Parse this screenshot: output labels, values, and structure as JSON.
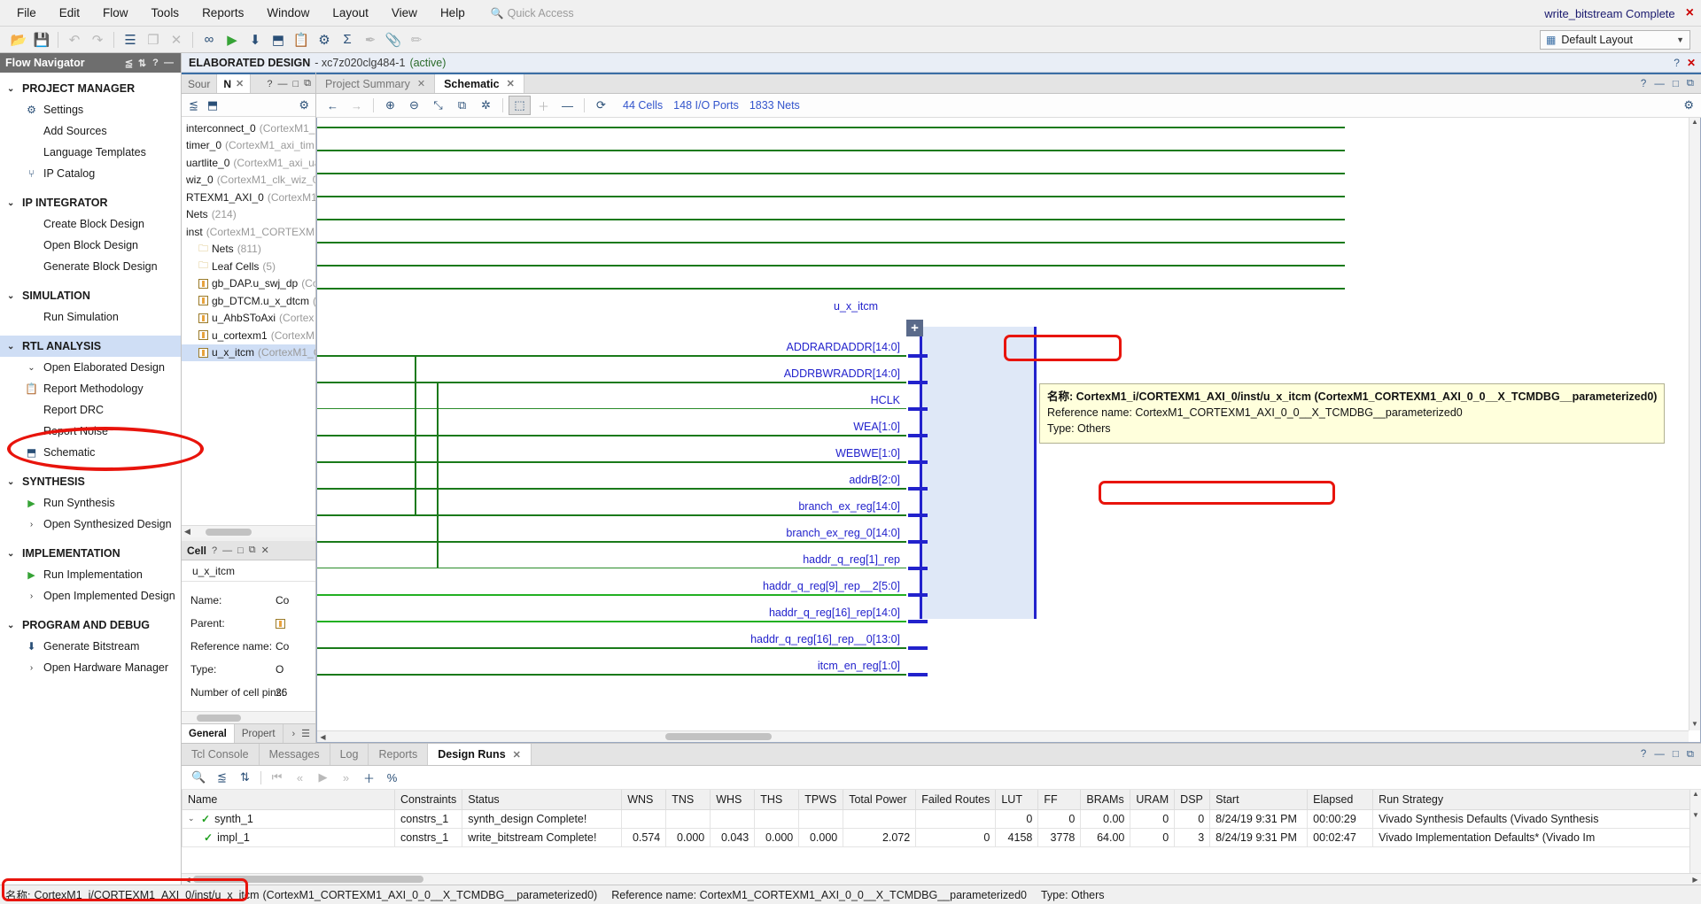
{
  "menubar": {
    "items": [
      "File",
      "Edit",
      "Flow",
      "Tools",
      "Reports",
      "Window",
      "Layout",
      "View",
      "Help"
    ],
    "quick_access_placeholder": "Quick Access",
    "status": "write_bitstream Complete",
    "close_label": "×"
  },
  "toolbar": {
    "layout_label": "Default Layout",
    "buttons": [
      {
        "name": "open-project-icon",
        "glyph": "📂",
        "state": "enabled"
      },
      {
        "name": "save-icon",
        "glyph": "💾",
        "state": "disabled"
      },
      {
        "name": "undo-icon",
        "glyph": "↶",
        "state": "disabled"
      },
      {
        "name": "redo-icon",
        "glyph": "↷",
        "state": "disabled"
      },
      {
        "name": "report-icon",
        "glyph": "☰",
        "state": "enabled"
      },
      {
        "name": "copy-icon",
        "glyph": "❐",
        "state": "disabled"
      },
      {
        "name": "close-icon",
        "glyph": "✕",
        "state": "disabled"
      },
      {
        "name": "binoculars-icon",
        "glyph": "∞",
        "state": "enabled"
      },
      {
        "name": "run-icon",
        "glyph": "▶",
        "state": "green"
      },
      {
        "name": "generate-bitstream-icon",
        "glyph": "⬇",
        "state": "enabled"
      },
      {
        "name": "schematic-icon",
        "glyph": "⬒",
        "state": "enabled"
      },
      {
        "name": "report-methodology-icon",
        "glyph": "📋",
        "state": "enabled"
      },
      {
        "name": "settings-gear-icon",
        "glyph": "⚙",
        "state": "enabled"
      },
      {
        "name": "sum-icon",
        "glyph": "Σ",
        "state": "enabled"
      },
      {
        "name": "marker-icon",
        "glyph": "✒",
        "state": "disabled"
      },
      {
        "name": "pin-icon",
        "glyph": "📎",
        "state": "disabled"
      },
      {
        "name": "ruler-icon",
        "glyph": "✃",
        "state": "disabled"
      }
    ]
  },
  "flow_navigator": {
    "title": "Flow Navigator",
    "header_buttons": [
      "⨍",
      "⇅",
      "?",
      "—"
    ],
    "sections": [
      {
        "label": "PROJECT MANAGER",
        "highlight": false,
        "items": [
          {
            "label": "Settings",
            "icon": "gear-icon",
            "glyph": "⚙"
          },
          {
            "label": "Add Sources",
            "icon": "",
            "glyph": ""
          },
          {
            "label": "Language Templates",
            "icon": "",
            "glyph": ""
          },
          {
            "label": "IP Catalog",
            "icon": "ip-catalog-icon",
            "glyph": "⑂"
          }
        ]
      },
      {
        "label": "IP INTEGRATOR",
        "highlight": false,
        "items": [
          {
            "label": "Create Block Design",
            "icon": "",
            "glyph": ""
          },
          {
            "label": "Open Block Design",
            "icon": "",
            "glyph": ""
          },
          {
            "label": "Generate Block Design",
            "icon": "",
            "glyph": ""
          }
        ]
      },
      {
        "label": "SIMULATION",
        "highlight": false,
        "items": [
          {
            "label": "Run Simulation",
            "icon": "",
            "glyph": ""
          }
        ]
      },
      {
        "label": "RTL ANALYSIS",
        "highlight": true,
        "items": [
          {
            "label": "Open Elaborated Design",
            "icon": "chevron-down-icon",
            "glyph": "⌄"
          },
          {
            "label": "Report Methodology",
            "icon": "clipboard-icon",
            "glyph": "📋"
          },
          {
            "label": "Report DRC",
            "icon": "",
            "glyph": ""
          },
          {
            "label": "Report Noise",
            "icon": "",
            "glyph": ""
          },
          {
            "label": "Schematic",
            "icon": "schematic-icon",
            "glyph": "⬒"
          }
        ]
      },
      {
        "label": "SYNTHESIS",
        "highlight": false,
        "items": [
          {
            "label": "Run Synthesis",
            "icon": "play-icon",
            "glyph": "▶"
          },
          {
            "label": "Open Synthesized Design",
            "icon": "chevron-right-icon",
            "glyph": "›"
          }
        ]
      },
      {
        "label": "IMPLEMENTATION",
        "highlight": false,
        "items": [
          {
            "label": "Run Implementation",
            "icon": "play-icon",
            "glyph": "▶"
          },
          {
            "label": "Open Implemented Design",
            "icon": "chevron-right-icon",
            "glyph": "›"
          }
        ]
      },
      {
        "label": "PROGRAM AND DEBUG",
        "highlight": false,
        "items": [
          {
            "label": "Generate Bitstream",
            "icon": "generate-bitstream-icon",
            "glyph": "⬇"
          },
          {
            "label": "Open Hardware Manager",
            "icon": "chevron-right-icon",
            "glyph": "›"
          }
        ]
      }
    ]
  },
  "elaborated_bar": {
    "title": "ELABORATED DESIGN",
    "subtitle": "- xc7z020clg484-1",
    "active": "(active)",
    "help": "?",
    "close": "✕"
  },
  "sources_panel": {
    "tabs": [
      {
        "label": "Sour",
        "active": false
      },
      {
        "label": "N",
        "active": true
      }
    ],
    "toolbar_icons": [
      "collapse-all-icon",
      "schematic-icon"
    ],
    "tree": [
      {
        "label": "interconnect_0",
        "detail": "(CortexM1_",
        "indent": 0,
        "icon": "none"
      },
      {
        "label": "timer_0",
        "detail": "(CortexM1_axi_tim",
        "indent": 0,
        "icon": "none"
      },
      {
        "label": "uartlite_0",
        "detail": "(CortexM1_axi_ua",
        "indent": 0,
        "icon": "none"
      },
      {
        "label": "wiz_0",
        "detail": "(CortexM1_clk_wiz_0",
        "indent": 0,
        "icon": "none"
      },
      {
        "label": "RTEXM1_AXI_0",
        "detail": "(CortexM1_",
        "indent": 0,
        "icon": "none"
      },
      {
        "label": "Nets",
        "detail": "(214)",
        "indent": 0,
        "icon": "none"
      },
      {
        "label": "inst",
        "detail": "(CortexM1_CORTEXM1",
        "indent": 0,
        "icon": "none"
      },
      {
        "label": "Nets",
        "detail": "(811)",
        "indent": 1,
        "icon": "folder"
      },
      {
        "label": "Leaf Cells",
        "detail": "(5)",
        "indent": 1,
        "icon": "folder"
      },
      {
        "label": "gb_DAP.u_swj_dp",
        "detail": "(Co",
        "indent": 1,
        "icon": "cell"
      },
      {
        "label": "gb_DTCM.u_x_dtcm",
        "detail": "(C",
        "indent": 1,
        "icon": "cell"
      },
      {
        "label": "u_AhbSToAxi",
        "detail": "(Cortex",
        "indent": 1,
        "icon": "cell"
      },
      {
        "label": "u_cortexm1",
        "detail": "(CortexM1_",
        "indent": 1,
        "icon": "cell"
      },
      {
        "label": "u_x_itcm",
        "detail": "(CortexM1_C",
        "indent": 1,
        "icon": "cell",
        "selected": true
      }
    ]
  },
  "cell_panel": {
    "title": "Cell",
    "header_buttons": [
      "?",
      "—",
      "□",
      "❐",
      "✕"
    ],
    "cell_name": "u_x_itcm",
    "nav_left": "←",
    "nav_more": "»",
    "properties": [
      {
        "key": "Name:",
        "value": "Co"
      },
      {
        "key": "Parent:",
        "value": "",
        "has_icon": true
      },
      {
        "key": "Reference name:",
        "value": "Co"
      },
      {
        "key": "Type:",
        "value": "O"
      },
      {
        "key": "Number of cell pins:",
        "value": "26"
      }
    ],
    "tabs": [
      {
        "label": "General",
        "active": true
      },
      {
        "label": "Propert",
        "active": false
      }
    ],
    "tabs_right": [
      "›",
      "☰"
    ]
  },
  "schematic": {
    "tabs": [
      {
        "label": "Project Summary",
        "active": false
      },
      {
        "label": "Schematic",
        "active": true
      }
    ],
    "tabs_right": [
      "?",
      "—",
      "□",
      "❐"
    ],
    "toolbar": {
      "buttons": [
        {
          "name": "back-icon",
          "glyph": "←",
          "state": "enabled"
        },
        {
          "name": "forward-icon",
          "glyph": "→",
          "state": "disabled"
        },
        {
          "name": "zoom-in-icon",
          "glyph": "⊕",
          "state": "enabled"
        },
        {
          "name": "zoom-out-icon",
          "glyph": "⊖",
          "state": "enabled"
        },
        {
          "name": "zoom-fit-icon",
          "glyph": "⤡",
          "state": "enabled"
        },
        {
          "name": "zoom-area-icon",
          "glyph": "⧉",
          "state": "enabled"
        },
        {
          "name": "locate-icon",
          "glyph": "✲",
          "state": "enabled"
        },
        {
          "name": "expand-cell-icon",
          "glyph": "⬚",
          "state": "pressed"
        },
        {
          "name": "add-icon",
          "glyph": "＋",
          "state": "disabled"
        },
        {
          "name": "remove-icon",
          "glyph": "—",
          "state": "enabled"
        },
        {
          "name": "reload-icon",
          "glyph": "⟳",
          "state": "enabled"
        }
      ],
      "counts": [
        "44 Cells",
        "148 I/O Ports",
        "1833 Nets"
      ],
      "settings_icon": "gear-icon"
    },
    "block": {
      "title": "u_x_itcm",
      "expand_glyph": "+"
    },
    "port_labels": [
      "ADDRARDADDR[14:0]",
      "ADDRBWRADDR[14:0]",
      "HCLK",
      "WEA[1:0]",
      "WEBWE[1:0]",
      "addrB[2:0]",
      "branch_ex_reg[14:0]",
      "branch_ex_reg_0[14:0]",
      "haddr_q_reg[1]_rep",
      "haddr_q_reg[9]_rep__2[5:0]",
      "haddr_q_reg[16]_rep[14:0]",
      "haddr_q_reg[16]_rep__0[13:0]",
      "itcm_en_reg[1:0]"
    ],
    "tooltip": {
      "label_prefix": "名称:",
      "instance_path": "CortexM1_i/CORTEXM1_AXI_0/inst/u_x_itcm",
      "paren": "(CortexM1_CORTEXM1_AXI_0_0__X_TCMDBG__parameterized0)",
      "reference_line": "Reference name: CortexM1_CORTEXM1_AXI_0_0__X_TCMDBG__parameterized0",
      "type_line": "Type: Others"
    }
  },
  "bottom_panel": {
    "tabs": [
      {
        "label": "Tcl Console",
        "active": false
      },
      {
        "label": "Messages",
        "active": false
      },
      {
        "label": "Log",
        "active": false
      },
      {
        "label": "Reports",
        "active": false
      },
      {
        "label": "Design Runs",
        "active": true
      }
    ],
    "tabs_right": [
      "?",
      "—",
      "□",
      "❐"
    ],
    "toolbar": [
      {
        "name": "search-icon",
        "glyph": "🔍",
        "state": "enabled"
      },
      {
        "name": "collapse-all-icon",
        "glyph": "⨍",
        "state": "enabled"
      },
      {
        "name": "expand-all-icon",
        "glyph": "⇅",
        "state": "enabled"
      },
      {
        "name": "first-icon",
        "glyph": "⏮",
        "state": "disabled"
      },
      {
        "name": "prev-icon",
        "glyph": "«",
        "state": "disabled"
      },
      {
        "name": "next-icon",
        "glyph": "▶",
        "state": "disabled"
      },
      {
        "name": "last-icon",
        "glyph": "»",
        "state": "disabled"
      },
      {
        "name": "add-run-icon",
        "glyph": "＋",
        "state": "enabled"
      },
      {
        "name": "percent-icon",
        "glyph": "%",
        "state": "enabled"
      }
    ],
    "table": {
      "columns": [
        "Name",
        "Constraints",
        "Status",
        "WNS",
        "TNS",
        "WHS",
        "THS",
        "TPWS",
        "Total Power",
        "Failed Routes",
        "LUT",
        "FF",
        "BRAMs",
        "URAM",
        "DSP",
        "Start",
        "Elapsed",
        "Run Strategy"
      ],
      "rows": [
        {
          "name": "synth_1",
          "indent": 0,
          "expandable": true,
          "check": true,
          "constraints": "constrs_1",
          "status": "synth_design Complete!",
          "wns": "",
          "tns": "",
          "whs": "",
          "ths": "",
          "tpws": "",
          "total_power": "",
          "failed_routes": "",
          "lut": "0",
          "ff": "0",
          "brams": "0.00",
          "uram": "0",
          "dsp": "0",
          "start": "8/24/19 9:31 PM",
          "elapsed": "00:00:29",
          "strategy": "Vivado Synthesis Defaults (Vivado Synthesis"
        },
        {
          "name": "impl_1",
          "indent": 1,
          "expandable": false,
          "check": true,
          "constraints": "constrs_1",
          "status": "write_bitstream Complete!",
          "wns": "0.574",
          "tns": "0.000",
          "whs": "0.043",
          "ths": "0.000",
          "tpws": "0.000",
          "total_power": "2.072",
          "failed_routes": "0",
          "lut": "4158",
          "ff": "3778",
          "brams": "64.00",
          "uram": "0",
          "dsp": "3",
          "start": "8/24/19 9:31 PM",
          "elapsed": "00:02:47",
          "strategy": "Vivado Implementation Defaults* (Vivado Im"
        }
      ]
    }
  },
  "statusbar": {
    "label_prefix": "名称:",
    "instance_path": "CortexM1_i/CORTEXM1_AXI_0/inst/u_x_itcm",
    "paren": "(CortexM1_CORTEXM1_AXI_0_0__X_TCMDBG__parameterized0)",
    "reference": "Reference name: CortexM1_CORTEXM1_AXI_0_0__X_TCMDBG__parameterized0",
    "type": "Type: Others"
  },
  "colors": {
    "accent_blue": "#3a6ea5",
    "annotation_red": "#e8140c",
    "wire_green": "#1a7a1a",
    "block_blue": "#2222cc",
    "highlight": "#cfdef5"
  }
}
